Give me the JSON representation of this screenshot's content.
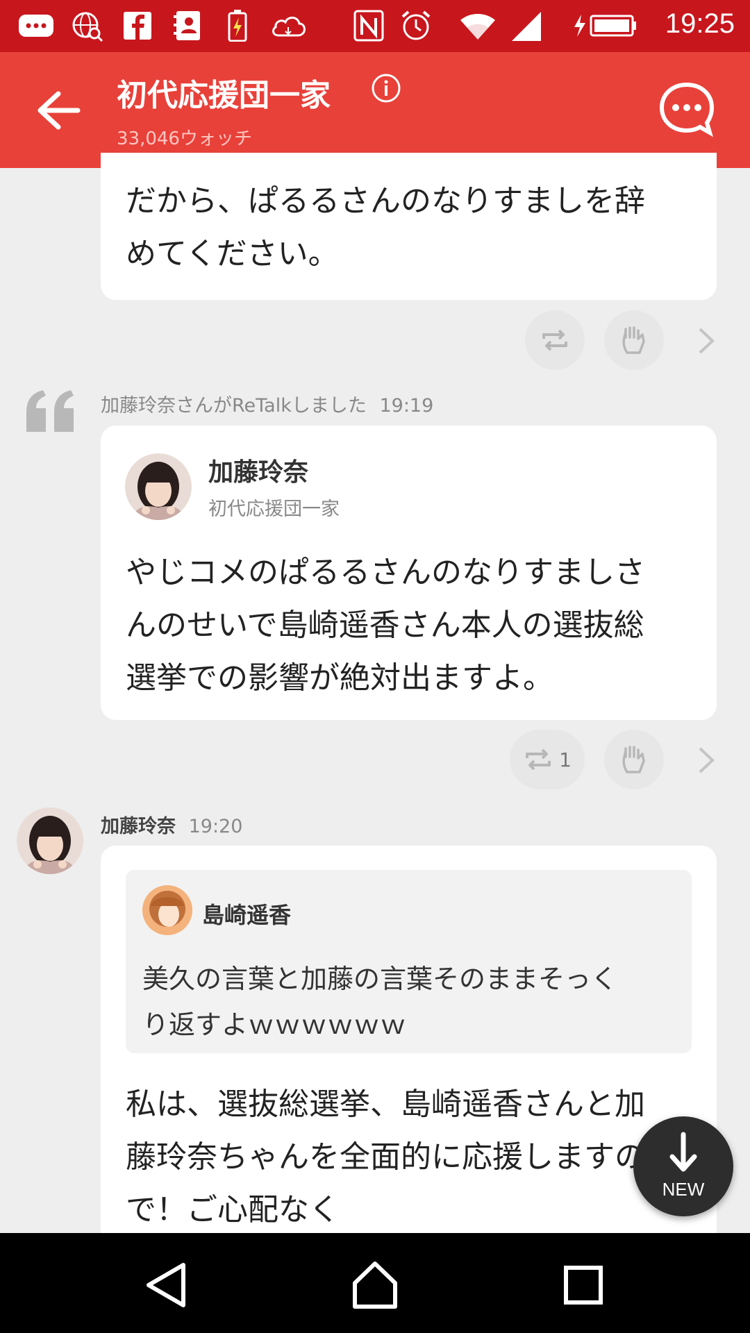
{
  "status_bar": {
    "time": "19:25",
    "icons": [
      "message-icon",
      "globe-search-icon",
      "facebook-icon",
      "contacts-icon",
      "battery-charging-icon",
      "cloud-icon",
      "nfc-icon",
      "alarm-icon",
      "wifi-icon",
      "signal-icon",
      "battery-icon"
    ]
  },
  "header": {
    "title": "初代応援団一家",
    "subtitle": "33,046ウォッチ",
    "icons": [
      "back-arrow-icon",
      "info-icon",
      "chat-bubble-icon"
    ]
  },
  "messages": {
    "top_snippet": {
      "text_line1": "だから、ぱるるさんのなりすましを辞",
      "text_line2": "めてください。"
    },
    "retalk": {
      "notice": "加藤玲奈さんがReTalkしました",
      "time": "19:19",
      "author": "加藤玲奈",
      "group": "初代応援団一家",
      "text_line1": "やじコメのぱるるさんのなりすましさ",
      "text_line2": "んのせいで島崎遥香さん本人の選抜総",
      "text_line3": "選挙での影響が絶対出ますよ。",
      "retalk_count": "1"
    },
    "reply": {
      "author": "加藤玲奈",
      "time": "19:20",
      "quoted_author": "島崎遥香",
      "quoted_line1": "美久の言葉と加藤の言葉そのままそっく",
      "quoted_line2": "り返すよｗｗｗｗｗｗ",
      "text_line1": "私は、選抜総選挙、島崎遥香さんと加",
      "text_line2": "藤玲奈ちゃんを全面的に応援しますの",
      "text_line3": "で！ご心配なく"
    }
  },
  "fab": {
    "label": "NEW"
  },
  "colors": {
    "status_bar": "#c8161d",
    "app_bar": "#e8413a",
    "background": "#eeeeee"
  }
}
